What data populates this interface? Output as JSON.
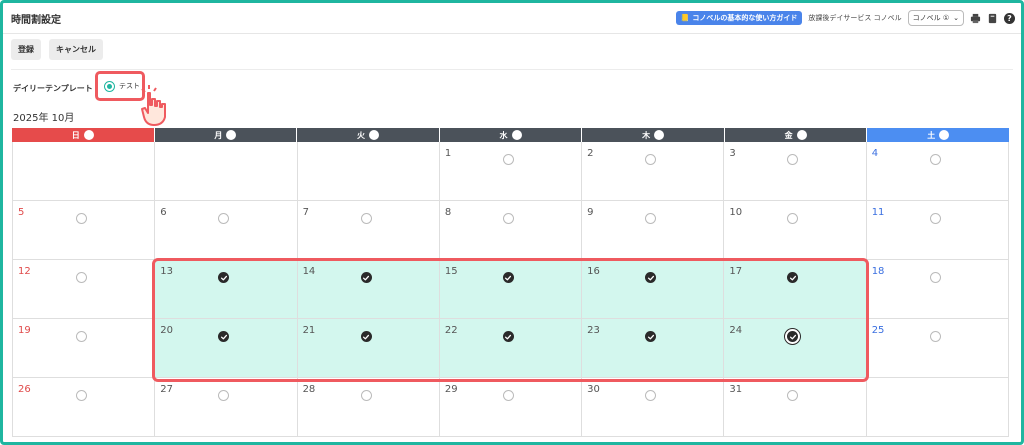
{
  "header": {
    "title": "時間割設定",
    "guide_label": "コノベルの基本的な使い方ガイド",
    "facility_name": "放課後デイサービス コノベル",
    "user_select": "コノベル ①"
  },
  "actions": {
    "register_label": "登録",
    "cancel_label": "キャンセル"
  },
  "template": {
    "label": "デイリーテンプレート",
    "option": "テスト",
    "selected": true
  },
  "calendar": {
    "month_label": "2025年 10月",
    "weekdays": [
      "日",
      "月",
      "火",
      "水",
      "木",
      "金",
      "土"
    ],
    "weeks": [
      [
        {
          "d": ""
        },
        {
          "d": ""
        },
        {
          "d": ""
        },
        {
          "d": "1",
          "c": false
        },
        {
          "d": "2",
          "c": false
        },
        {
          "d": "3",
          "c": false
        },
        {
          "d": "4",
          "c": false
        }
      ],
      [
        {
          "d": "5",
          "c": false
        },
        {
          "d": "6",
          "c": false
        },
        {
          "d": "7",
          "c": false
        },
        {
          "d": "8",
          "c": false
        },
        {
          "d": "9",
          "c": false
        },
        {
          "d": "10",
          "c": false
        },
        {
          "d": "11",
          "c": false
        }
      ],
      [
        {
          "d": "12",
          "c": false
        },
        {
          "d": "13",
          "c": true
        },
        {
          "d": "14",
          "c": true
        },
        {
          "d": "15",
          "c": true
        },
        {
          "d": "16",
          "c": true
        },
        {
          "d": "17",
          "c": true
        },
        {
          "d": "18",
          "c": false
        }
      ],
      [
        {
          "d": "19",
          "c": false
        },
        {
          "d": "20",
          "c": true
        },
        {
          "d": "21",
          "c": true
        },
        {
          "d": "22",
          "c": true
        },
        {
          "d": "23",
          "c": true
        },
        {
          "d": "24",
          "c": true,
          "f": true
        },
        {
          "d": "25",
          "c": false
        }
      ],
      [
        {
          "d": "26",
          "c": false
        },
        {
          "d": "27",
          "c": false
        },
        {
          "d": "28",
          "c": false
        },
        {
          "d": "29",
          "c": false
        },
        {
          "d": "30",
          "c": false
        },
        {
          "d": "31",
          "c": false
        },
        {
          "d": ""
        }
      ]
    ]
  },
  "colors": {
    "accent": "#1fb6a0",
    "sunday": "#e64b4b",
    "saturday": "#4c8ef2",
    "selected_bg": "#d3f7ee",
    "callout": "#ef5a5f"
  }
}
